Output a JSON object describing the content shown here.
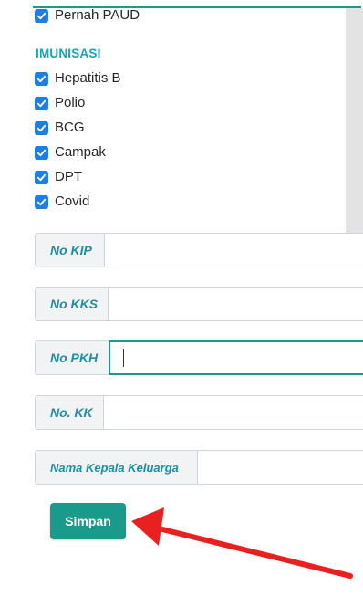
{
  "checkbox_top": {
    "label": "Pernah PAUD",
    "checked": true
  },
  "imunisasi": {
    "title": "IMUNISASI",
    "items": [
      {
        "label": "Hepatitis B",
        "checked": true
      },
      {
        "label": "Polio",
        "checked": true
      },
      {
        "label": "BCG",
        "checked": true
      },
      {
        "label": "Campak",
        "checked": true
      },
      {
        "label": "DPT",
        "checked": true
      },
      {
        "label": "Covid",
        "checked": true
      }
    ]
  },
  "fields": [
    {
      "label": "No KIP",
      "value": ""
    },
    {
      "label": "No KKS",
      "value": ""
    },
    {
      "label": "No PKH",
      "value": ""
    },
    {
      "label": "No. KK",
      "value": ""
    },
    {
      "label": "Nama Kepala Keluarga",
      "value": ""
    }
  ],
  "submit": {
    "label": "Simpan"
  },
  "colors": {
    "accent": "#1a9a8b",
    "checkbox": "#1e7fe0",
    "arrow": "#e8201f",
    "label_text": "#1d8fa3"
  }
}
